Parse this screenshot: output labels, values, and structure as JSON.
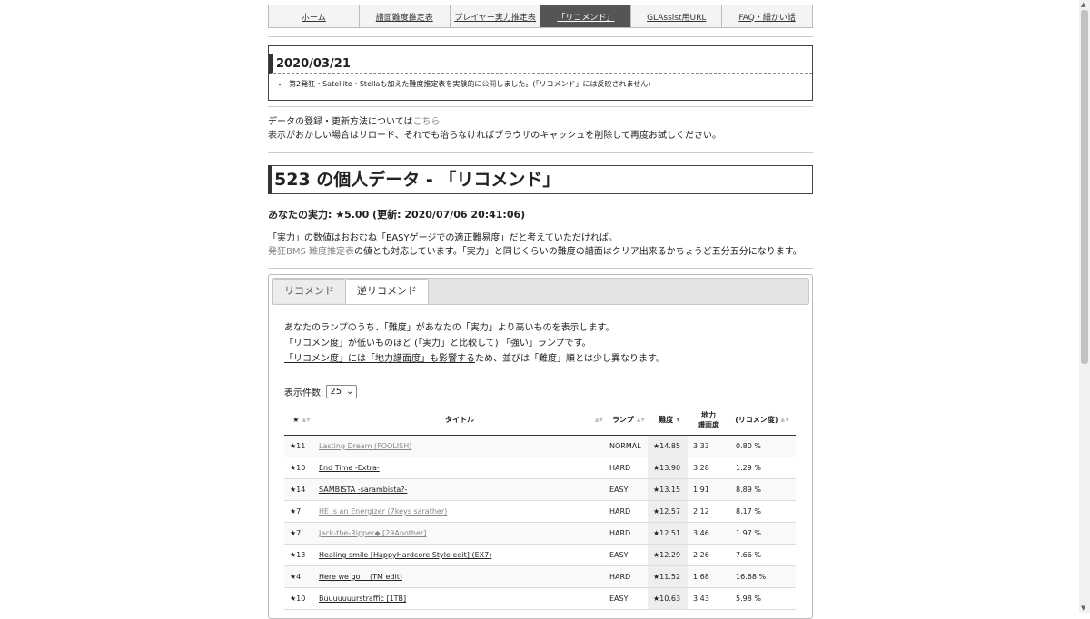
{
  "nav": [
    {
      "label": "ホーム",
      "active": false
    },
    {
      "label": "譜面難度推定表",
      "active": false
    },
    {
      "label": "プレイヤー実力推定表",
      "active": false
    },
    {
      "label": "「リコメンド」",
      "active": true
    },
    {
      "label": "GLAssist用URL",
      "active": false
    },
    {
      "label": "FAQ・細かい話",
      "active": false
    }
  ],
  "news": {
    "date": "2020/03/21",
    "item_pre": "第2発狂・Satellite・Stellaも加えた難度推定表を実験的に",
    "item_link": "公開",
    "item_post": "しました。(「リコメンド」には反映されません)"
  },
  "info": {
    "line1_pre": "データの登録・更新方法については",
    "line1_link": "こちら",
    "line2": "表示がおかしい場合はリロード、それでも治らなければブラウザのキャッシュを削除して再度お試しください。"
  },
  "heading": "523 の個人データ - 「リコメンド」",
  "power": "あなたの実力: ★5.00 (更新: 2020/07/06 20:41:06)",
  "desc": {
    "line1": "「実力」の数値はおおむね「EASYゲージでの適正難易度」だと考えていただければ。",
    "line2_link": "発狂BMS 難度推定表",
    "line2_post": "の値とも対応しています。「実力」と同じくらいの難度の譜面はクリア出来るかちょうど五分五分になります。"
  },
  "tabs": {
    "tab1": "リコメンド",
    "tab2": "逆リコメンド"
  },
  "tabbody": {
    "line1": "あなたのランプのうち、「難度」があなたの「実力」より高いものを表示します。",
    "line2": "「リコメン度」が低いものほど (「実力」と比較して) 「強い」ランプです。",
    "line3_u": "「リコメン度」には「地力譜面度」も影響する",
    "line3_post": "ため、並びは「難度」順とは少し異なります。"
  },
  "count": {
    "label": "表示件数:",
    "value": "25"
  },
  "table": {
    "headers": {
      "star": "★",
      "title": "タイトル",
      "lamp": "ランプ",
      "difficulty": "難度",
      "jiryoku_1": "地力",
      "jiryoku_2": "譜面度",
      "recommend": "(リコメン度)"
    },
    "rows": [
      {
        "star": "★11",
        "title": "Lasting Dream (FOOLISH)",
        "lamp": "NORMAL",
        "diff": "★14.85",
        "jiryoku": "3.33",
        "rec": "0.80 %",
        "grey": true
      },
      {
        "star": "★10",
        "title": "End Time -Extra-",
        "lamp": "HARD",
        "diff": "★13.90",
        "jiryoku": "3.28",
        "rec": "1.29 %",
        "grey": false
      },
      {
        "star": "★14",
        "title": "SAMBISTA -sarambista?-",
        "lamp": "EASY",
        "diff": "★13.15",
        "jiryoku": "1.91",
        "rec": "8.89 %",
        "grey": false
      },
      {
        "star": "★7",
        "title": "HE is an Energizer (7keys sarather)",
        "lamp": "HARD",
        "diff": "★12.57",
        "jiryoku": "2.12",
        "rec": "8.17 %",
        "grey": true
      },
      {
        "star": "★7",
        "title": "Jack-the-Ripper◆ [29Another]",
        "lamp": "HARD",
        "diff": "★12.51",
        "jiryoku": "3.46",
        "rec": "1.97 %",
        "grey": true
      },
      {
        "star": "★13",
        "title": "Healing smile [HappyHardcore Style edit] (EX7)",
        "lamp": "EASY",
        "diff": "★12.29",
        "jiryoku": "2.26",
        "rec": "7.66 %",
        "grey": false
      },
      {
        "star": "★4",
        "title": "Here we go！ (TM edit)",
        "lamp": "HARD",
        "diff": "★11.52",
        "jiryoku": "1.68",
        "rec": "16.68 %",
        "grey": false
      },
      {
        "star": "★10",
        "title": "Buuuuuuurstraffic [1TB]",
        "lamp": "EASY",
        "diff": "★10.63",
        "jiryoku": "3.43",
        "rec": "5.98 %",
        "grey": false
      }
    ]
  }
}
